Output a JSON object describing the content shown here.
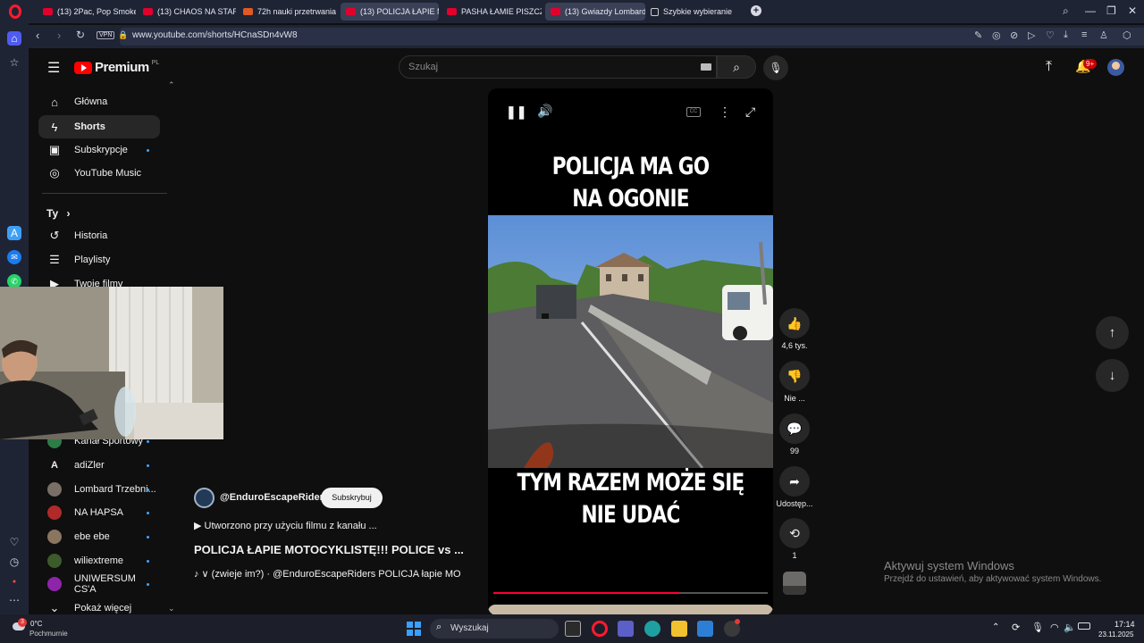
{
  "browser": {
    "tabs": [
      {
        "label": "(13) 2Pac, Pop Smoke - W",
        "active": false
      },
      {
        "label": "(13) CHAOS NA STARCIE,",
        "active": false
      },
      {
        "label": "72h nauki przetrwania - o",
        "active": false
      },
      {
        "label": "(13) POLICJA ŁAPIE M",
        "active": true
      },
      {
        "label": "PASHA ŁAMIE PISZCZEL!",
        "active": false
      },
      {
        "label": "(13) Gwiazdy Lombard",
        "active": true
      },
      {
        "label": "Szybkie wybieranie",
        "active": false
      }
    ],
    "vpn_label": "VPN",
    "url": "www.youtube.com/shorts/HCnaSDn4vW8"
  },
  "youtube": {
    "logo_text": "Premium",
    "logo_superscript": "PL",
    "search_placeholder": "Szukaj",
    "notification_badge": "9+",
    "sidebar": {
      "main": [
        {
          "label": "Główna",
          "icon": "home-icon"
        },
        {
          "label": "Shorts",
          "icon": "shorts-icon"
        },
        {
          "label": "Subskrypcje",
          "icon": "subscriptions-icon"
        },
        {
          "label": "YouTube Music",
          "icon": "music-icon"
        }
      ],
      "you_heading": "Ty",
      "you_items": [
        {
          "label": "Historia",
          "icon": "history-icon"
        },
        {
          "label": "Playlisty",
          "icon": "playlists-icon"
        },
        {
          "label": "Twoje filmy",
          "icon": "your-videos-icon"
        }
      ],
      "channels": [
        {
          "label": "Kanał Sportowy"
        },
        {
          "label": "adiZler"
        },
        {
          "label": "Lombard Trzebni..."
        },
        {
          "label": "NA HAPSA"
        },
        {
          "label": "ebe ebe"
        },
        {
          "label": "wiliextreme"
        },
        {
          "label": "UNIWERSUM CS'A"
        }
      ],
      "show_more": "Pokaż więcej"
    },
    "short": {
      "caption_top_1": "POLICJA MA GO",
      "caption_top_2": "NA OGONIE",
      "caption_bottom_1": "TYM RAZEM MOŻE SIĘ",
      "caption_bottom_2": "NIE UDAĆ",
      "channel": "@EnduroEscapeRiders",
      "subscribe": "Subskrybuj",
      "remix_note": "▶ Utworzono przy użyciu filmu z kanału ...",
      "title": "POLICJA ŁAPIE MOTOCYKLISTĘ!!! POLICE vs ...",
      "audio_line": "♪ ∨ (zwieje im?) · @EnduroEscapeRiders    POLICJA łapie MOTO",
      "progress": 0.68
    },
    "actions": {
      "likes": "4,6 tys.",
      "dislike": "Nie ...",
      "comments": "99",
      "share": "Udostęp...",
      "remix": "1"
    }
  },
  "watermark": {
    "line1": "Aktywuj system Windows",
    "line2": "Przejdź do ustawień, aby aktywować system Windows."
  },
  "taskbar": {
    "weather_badge": "3",
    "temperature": "0°C",
    "weather": "Pochmurnie",
    "search": "Wyszukaj",
    "time": "17:14",
    "date": "23.11.2025"
  }
}
